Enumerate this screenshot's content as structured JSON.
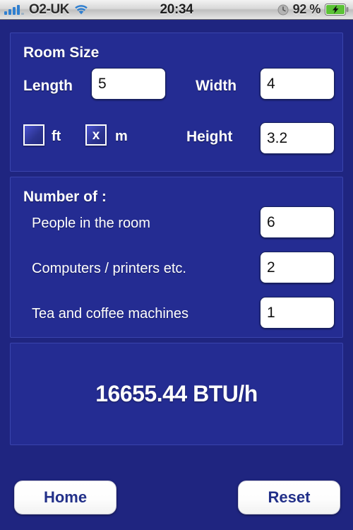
{
  "status_bar": {
    "carrier": "O2-UK",
    "time": "20:34",
    "battery_percent": "92 %",
    "icons": {
      "signal": "signal-bars-icon",
      "wifi": "wifi-icon",
      "clock": "clock-icon",
      "battery": "battery-charging-icon"
    }
  },
  "room_size": {
    "title": "Room Size",
    "length_label": "Length",
    "length_value": "5",
    "width_label": "Width",
    "width_value": "4",
    "unit_ft_label": "ft",
    "unit_ft_checked": false,
    "unit_ft_mark": "",
    "unit_m_label": "m",
    "unit_m_checked": true,
    "unit_m_mark": "x",
    "height_label": "Height",
    "height_value": "3.2"
  },
  "number_of": {
    "title": "Number of :",
    "rows": [
      {
        "label": "People in the room",
        "value": "6"
      },
      {
        "label": "Computers / printers etc.",
        "value": "2"
      },
      {
        "label": "Tea and coffee machines",
        "value": "1"
      }
    ]
  },
  "result": {
    "text": "16655.44 BTU/h"
  },
  "toolbar": {
    "home_label": "Home",
    "reset_label": "Reset"
  },
  "colors": {
    "background": "#1f2580",
    "panel": "#242c92",
    "panel_border": "#3a44ad",
    "text": "#ffffff",
    "button_text": "#223089",
    "battery_green": "#5bc236"
  }
}
